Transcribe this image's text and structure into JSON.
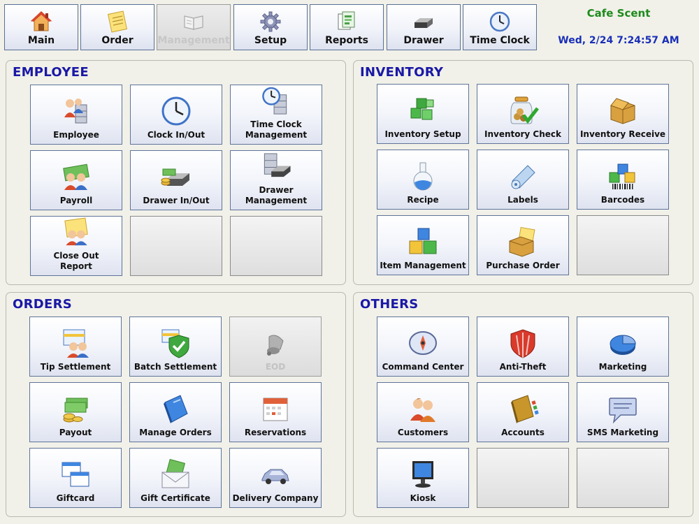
{
  "nav": {
    "items": [
      {
        "label": "Main",
        "icon": "house-icon"
      },
      {
        "label": "Order",
        "icon": "sticky-note-icon"
      },
      {
        "label": "Management",
        "icon": "open-book-icon",
        "state": "active-disabled"
      },
      {
        "label": "Setup",
        "icon": "gear-icon"
      },
      {
        "label": "Reports",
        "icon": "reports-icon"
      },
      {
        "label": "Drawer",
        "icon": "cash-drawer-icon"
      },
      {
        "label": "Time Clock",
        "icon": "clock-icon"
      }
    ]
  },
  "header": {
    "store_name": "Cafe Scent",
    "datetime": "Wed, 2/24 7:24:57 AM"
  },
  "panels": {
    "employee": {
      "title": "EMPLOYEE",
      "tiles": [
        {
          "label": "Employee",
          "icon": "employee-cabinet-icon"
        },
        {
          "label": "Clock In/Out",
          "icon": "clock-icon"
        },
        {
          "label": "Time Clock\nManagement",
          "icon": "time-clock-cabinet-icon"
        },
        {
          "label": "Payroll",
          "icon": "payroll-icon"
        },
        {
          "label": "Drawer In/Out",
          "icon": "drawer-cash-icon"
        },
        {
          "label": "Drawer\nManagement",
          "icon": "drawer-cabinet-icon"
        },
        {
          "label": "Close Out\nReport",
          "icon": "close-out-report-icon"
        }
      ]
    },
    "inventory": {
      "title": "INVENTORY",
      "tiles": [
        {
          "label": "Inventory Setup",
          "icon": "green-cubes-icon"
        },
        {
          "label": "Inventory Check",
          "icon": "jar-check-icon"
        },
        {
          "label": "Inventory Receive",
          "icon": "cardboard-box-icon"
        },
        {
          "label": "Recipe",
          "icon": "flask-icon"
        },
        {
          "label": "Labels",
          "icon": "label-roll-icon"
        },
        {
          "label": "Barcodes",
          "icon": "barcode-blocks-icon"
        },
        {
          "label": "Item Management",
          "icon": "color-cubes-icon"
        },
        {
          "label": "Purchase Order",
          "icon": "purchase-order-box-icon"
        }
      ]
    },
    "orders": {
      "title": "ORDERS",
      "tiles": [
        {
          "label": "Tip Settlement",
          "icon": "tip-settlement-icon"
        },
        {
          "label": "Batch Settlement",
          "icon": "shield-check-icon"
        },
        {
          "label": "EOD",
          "icon": "bell-icon",
          "state": "disabled"
        },
        {
          "label": "Payout",
          "icon": "money-coins-icon"
        },
        {
          "label": "Manage Orders",
          "icon": "blue-book-icon"
        },
        {
          "label": "Reservations",
          "icon": "calendar-icon"
        },
        {
          "label": "Giftcard",
          "icon": "windows-cards-icon"
        },
        {
          "label": "Gift Certificate",
          "icon": "money-envelope-icon"
        },
        {
          "label": "Delivery Company",
          "icon": "car-icon"
        }
      ]
    },
    "others": {
      "title": "OTHERS",
      "tiles": [
        {
          "label": "Command Center",
          "icon": "compass-icon"
        },
        {
          "label": "Anti-Theft",
          "icon": "red-shield-icon"
        },
        {
          "label": "Marketing",
          "icon": "pie-chart-icon"
        },
        {
          "label": "Customers",
          "icon": "people-icon"
        },
        {
          "label": "Accounts",
          "icon": "address-book-icon"
        },
        {
          "label": "SMS Marketing",
          "icon": "speech-bubble-icon"
        },
        {
          "label": "Kiosk",
          "icon": "monitor-icon"
        }
      ]
    }
  },
  "colors": {
    "panel_title": "#1a18a6",
    "store_name": "#1d8a1d",
    "datetime": "#1a2fb8",
    "tile_border": "#5e7399"
  }
}
